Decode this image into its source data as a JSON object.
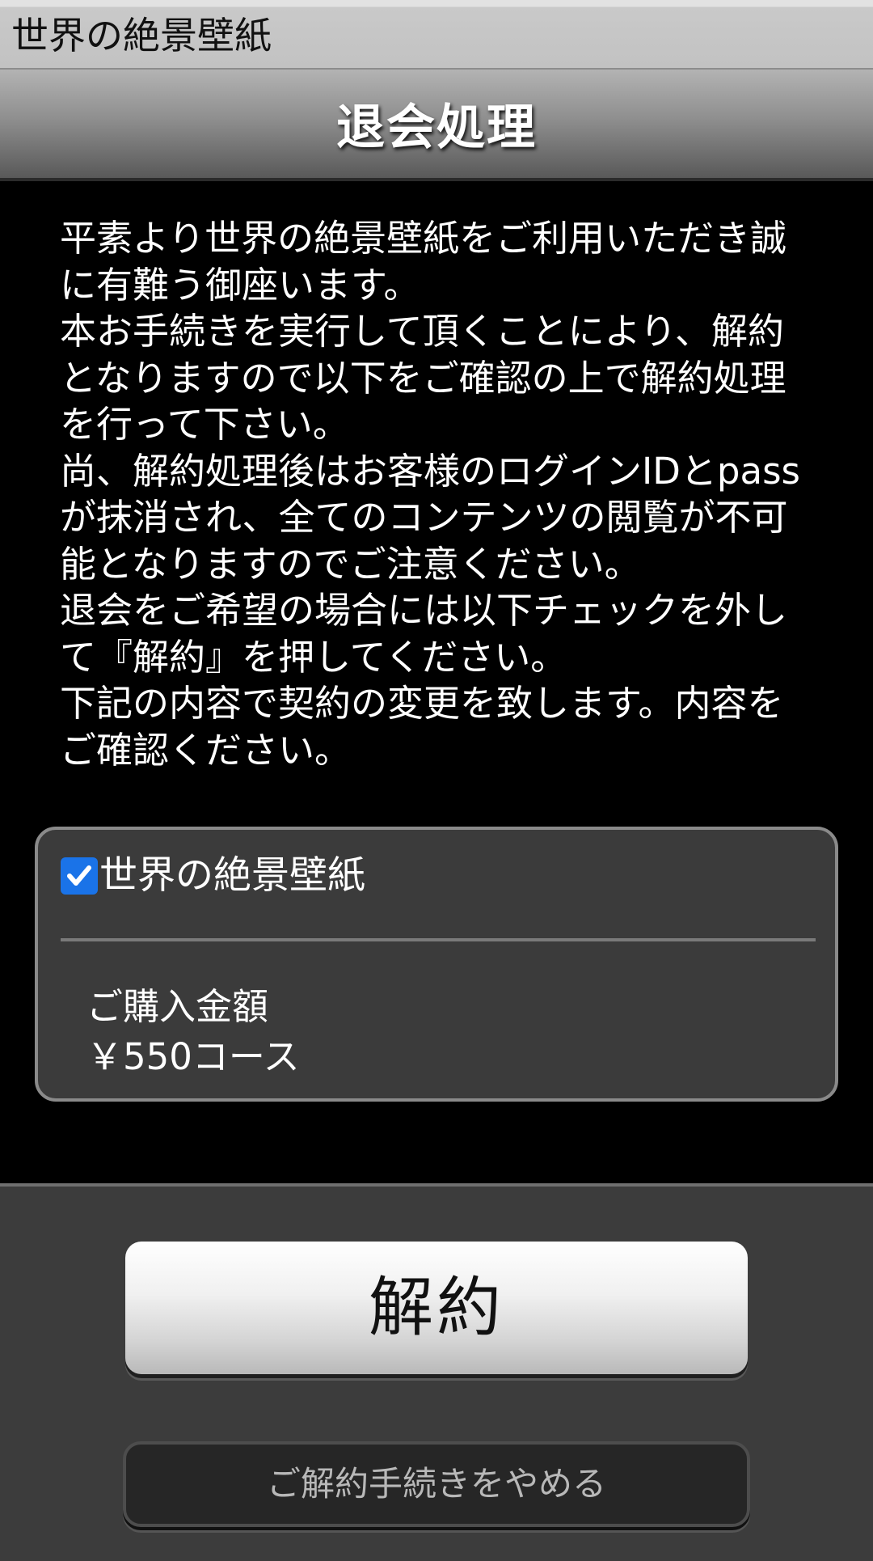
{
  "app": {
    "title": "世界の絶景壁紙"
  },
  "header": {
    "title": "退会処理"
  },
  "notice": {
    "lines": [
      "平素より世界の絶景壁紙をご利用いただき誠",
      "に有難う御座います。",
      "本お手続きを実行して頂くことにより、解約",
      "となりますので以下をご確認の上で解約処理",
      "を行って下さい。",
      "尚、解約処理後はお客様のログインIDとpass",
      "が抹消され、全てのコンテンツの閲覧が不可",
      "能となりますのでご注意ください。",
      "退会をご希望の場合には以下チェックを外し",
      "て『解約』を押してください。",
      "下記の内容で契約の変更を致します。内容を",
      "ご確認ください。"
    ]
  },
  "subscription": {
    "checked": true,
    "name": "世界の絶景壁紙",
    "price_label": "ご購入金額",
    "price_value": "￥550コース"
  },
  "actions": {
    "cancel_label": "解約",
    "stop_label": "ご解約手続きをやめる"
  },
  "colors": {
    "background": "#000000",
    "checkbox": "#1a73e8",
    "card": "#3b3b3b",
    "footer": "#3c3c3c"
  }
}
